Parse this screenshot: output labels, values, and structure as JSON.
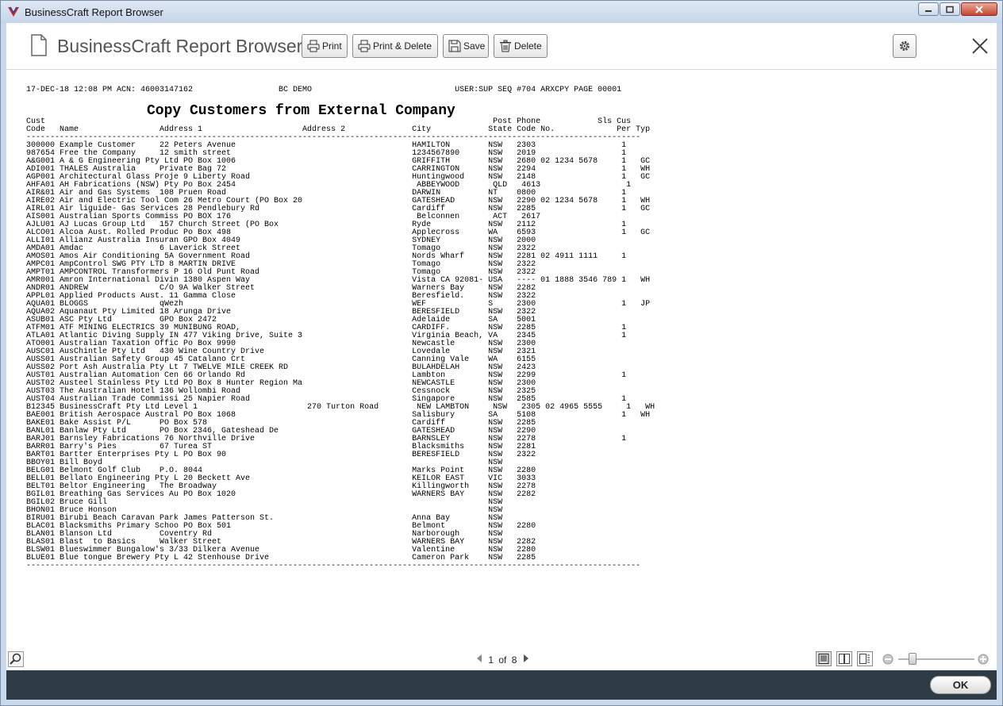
{
  "window": {
    "title": "BusinessCraft Report Browser"
  },
  "header": {
    "title": "BusinessCraft Report Browser",
    "buttons": {
      "print": "Print",
      "print_delete": "Print & Delete",
      "save": "Save",
      "delete": "Delete"
    }
  },
  "report": {
    "header_line": "17-DEC-18 12:08 PM ACN: 46003147162                  BC DEMO                              USER:SUP SEQ #704 ARXCPY PAGE 00001",
    "title": "Copy Customers from External Company",
    "columns": {
      "line1": "Cust                                                                                              Post Phone            Sls Cus",
      "line2": "Code   Name                 Address 1                     Address 2              City            State Code No.             Per Typ"
    },
    "separator": "---------------------------------------------------------------------------------------------------------------------------------",
    "rows": [
      "300000 Example Customer     22 Peters Avenue                                     HAMILTON        NSW   2303                  1",
      "987654 Free the Company     12 smith street                                      1234567890      NSW   2019                  1",
      "A&G001 A & G Engineering Pty Ltd PO Box 1006                                     GRIFFITH        NSW   2680 02 1234 5678     1   GC",
      "ADI001 THALES Australia     Private Bag 72                                       CARRINGTON      NSW   2294                  1   WH",
      "AGP001 Architectural Glass Proje 9 Liberty Road                                  Huntingwood     NSW   2148                  1   GC",
      "AHFA01 AH Fabrications (NSW) Pty Po Box 2454                                      ABBEYWOOD       QLD   4613                  1",
      "AIR&01 Air and Gas Systems  108 Pruen Road                                       DARWIN          NT    0800                  1",
      "AIRE02 Air and Electric Tool Com 26 Metro Court (PO Box 20                       GATESHEAD       NSW   2290 02 1234 5678     1   WH",
      "AIRL01 Air liguide- Gas Services 28 Pendlebury Rd                                Cardiff         NSW   2285                  1   GC",
      "AIS001 Australian Sports Commiss PO BOX 176                                       Belconnen       ACT   2617",
      "AJLU01 AJ Lucas Group Ltd   157 Church Street (PO Box                            Ryde            NSW   2112                  1",
      "ALCO01 Alcoa Aust. Rolled Produc Po Box 498                                      Applecross      WA    6593                  1   GC",
      "ALLI01 Allianz Australia Insuran GPO Box 4049                                    SYDNEY          NSW   2000",
      "AMDA01 Amdac                6 Laverick Street                                    Tomago          NSW   2322",
      "AMOS01 Amos Air Conditioning 5A Government Road                                  Nords Wharf     NSW   2281 02 4911 1111     1",
      "AMPC01 AmpControl SWG PTY LTD 8 MARTIN DRIVE                                     Tomago          NSW   2322",
      "AMPT01 AMPCONTROL Transformers P 16 Old Punt Road                                Tomago          NSW   2322",
      "AMR001 Amron International Divin 1380 Aspen Way                                  Vista CA 92081- USA   ---- 01 1888 3546 789 1   WH",
      "ANDR01 ANDREW               C/O 9A Walker Street                                 Warners Bay     NSW   2282",
      "APPL01 Applied Products Aust. 11 Gamma Close                                     Beresfield.     NSW   2322",
      "AQUA01 BLOGGS               qWezh                                                WEF             S     2300                  1   JP",
      "AQUA02 Aquanaut Pty Limited 18 Arunga Drive                                      BERESFIELD      NSW   2322",
      "ASUB01 ASC Pty Ltd          GPO Box 2472                                         Adelaide        SA    5001",
      "ATFM01 ATF MINING ELECTRICS 39 MUNIBUNG ROAD,                                    CARDIFF.        NSW   2285                  1",
      "ATLA01 Atlantic Diving Supply IN 477 Viking Drive, Suite 3                       Virginia Beach, VA    2345                  1",
      "ATO001 Australian Taxation Offic Po Box 9990                                     Newcastle       NSW   2300",
      "AUSC01 AusChintle Pty Ltd   430 Wine Country Drive                               Lovedale        NSW   2321",
      "AUSS01 Australian Safety Group 45 Catalano Crt                                   Canning Vale    WA    6155",
      "AUSS02 Port Ash Australia Pty Lt 7 TWELVE MILE CREEK RD                          BULAHDELAH      NSW   2423",
      "AUST01 Australian Automation Cen 66 Orlando Rd                                   Lambton         NSW   2299                  1",
      "AUST02 Austeel Stainless Pty Ltd PO Box 8 Hunter Region Ma                       NEWCASTLE       NSW   2300",
      "AUST03 The Australian Hotel 136 Wollombi Road                                    Cessnock        NSW   2325",
      "AUST04 Australian Trade Commissi 25 Napier Road                                  Singapore       NSW   2585                  1",
      "B12345 BusinessCraft Pty Ltd Level 1                       270 Turton Road        NEW LAMBTON     NSW   2305 02 4965 5555     1   WH",
      "BAE001 British Aerospace Austral PO Box 1068                                     Salisbury       SA    5108                  1   WH",
      "BAKE01 Bake Assist P/L      PO Box 578                                           Cardiff         NSW   2285",
      "BANL01 Banlaw Pty Ltd       PO Box 2346, Gateshead De                            GATESHEAD       NSW   2290",
      "BARJ01 Barnsley Fabrications 76 Northville Drive                                 BARNSLEY        NSW   2278                  1",
      "BARR01 Barry's Pies         67 Turea ST                                          Blacksmiths     NSW   2281",
      "BART01 Bartter Enterprises Pty L PO Box 90                                       BERESFIELD      NSW   2322",
      "BBOY01 Bill Boyd                                                                                 NSW",
      "BELG01 Belmont Golf Club    P.O. 8044                                            Marks Point     NSW   2280",
      "BELL01 Bellato Engineering Pty L 20 Beckett Ave                                  KEILOR EAST     VIC   3033",
      "BELT01 Beltor Engineering   The Broadway                                         Killingworth    NSW   2278",
      "BGIL01 Breathing Gas Services Au PO Box 1020                                     WARNERS BAY     NSW   2282",
      "BGIL02 Bruce Gill                                                                                NSW",
      "BHON01 Bruce Honson                                                                              NSW",
      "BIRU01 Birubi Beach Caravan Park James Patterson St.                             Anna Bay        NSW",
      "BLAC01 Blacksmiths Primary Schoo PO Box 501                                      Belmont         NSW   2280",
      "BLAN01 Blanson Ltd          Coventry Rd                                          Narborough      NSW",
      "BLAS01 Blast  to Basics     Walker Street                                        WARNERS BAY     NSW   2282",
      "BLSW01 Blueswimmer Bungalow's 3/33 Dilkera Avenue                                Valentine       NSW   2280",
      "BLUE01 Blue tongue Brewery Pty L 42 Stenhouse Drive                              Cameron Park    NSW   2285"
    ]
  },
  "pager": {
    "current": "1",
    "of_label": "of",
    "total": "8"
  },
  "zoom": {
    "level": 0.15
  },
  "footer": {
    "ok_label": "OK"
  },
  "icons": {
    "app": "businesscraft-logo-icon",
    "document": "document-icon",
    "print": "printer-icon",
    "save": "floppy-disk-icon",
    "delete": "trash-icon",
    "settings": "gear-icon",
    "close": "close-icon",
    "search": "search-icon"
  },
  "colors": {
    "footer_bg": "#2f3b44",
    "title_text": "#555555",
    "logo_red": "#d2232a",
    "logo_blue": "#1e4e9c"
  }
}
